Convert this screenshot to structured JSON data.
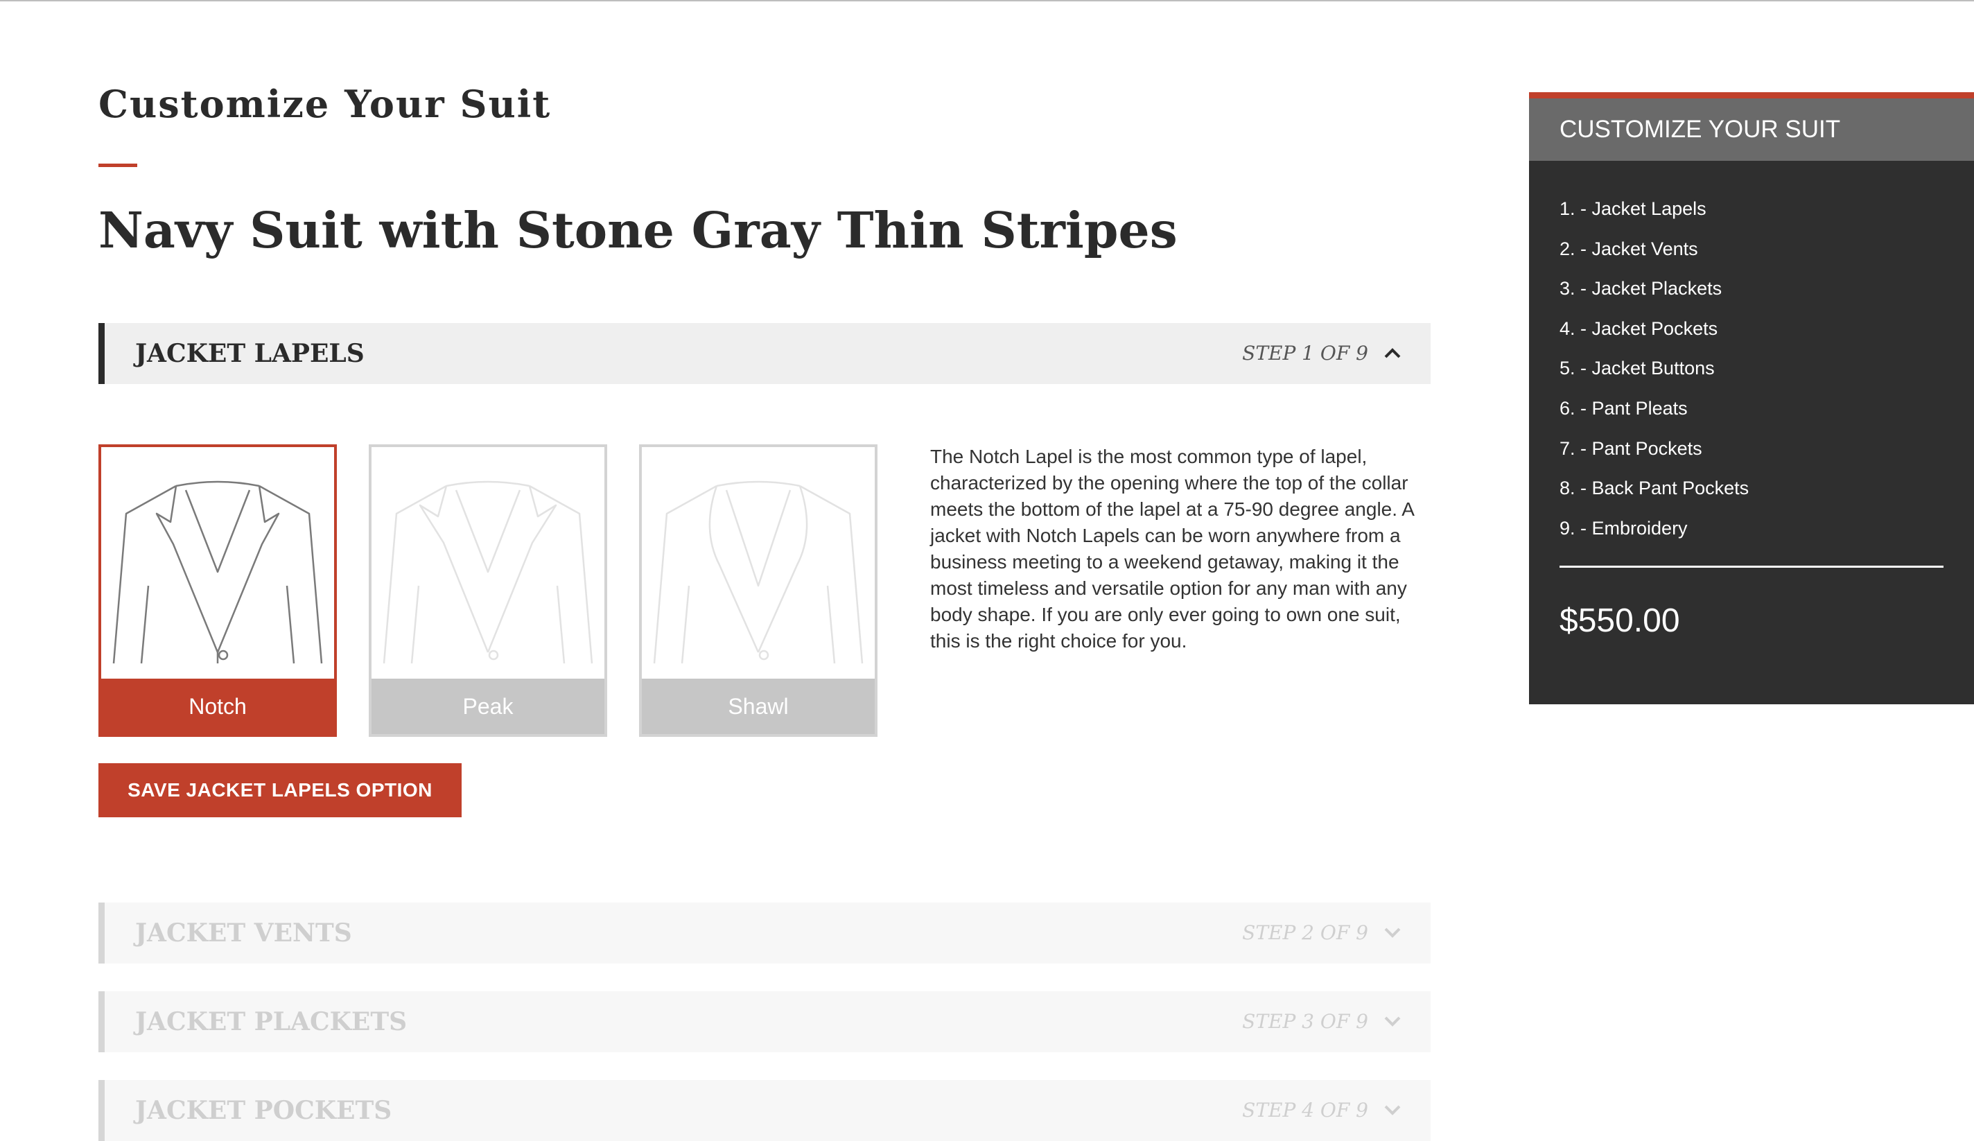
{
  "page": {
    "title": "Customize Your Suit",
    "suit_name": "Navy Suit with Stone Gray Thin Stripes"
  },
  "steps": [
    {
      "title": "Jacket Lapels",
      "count": "STEP 1 OF 9",
      "state": "expanded"
    },
    {
      "title": "Jacket Vents",
      "count": "STEP 2 OF 9",
      "state": "collapsed"
    },
    {
      "title": "Jacket Plackets",
      "count": "STEP 3 OF 9",
      "state": "collapsed"
    },
    {
      "title": "Jacket Pockets",
      "count": "STEP 4 OF 9",
      "state": "collapsed"
    }
  ],
  "lapel_options": [
    {
      "label": "Notch",
      "selected": true
    },
    {
      "label": "Peak",
      "selected": false
    },
    {
      "label": "Shawl",
      "selected": false
    }
  ],
  "description": "The Notch Lapel is the most common type of lapel, characterized by the opening where the top of the collar meets the bottom of the lapel at a 75-90 degree angle. A jacket with Notch Lapels can be worn anywhere from a business meeting to a weekend getaway, making it the most timeless and versatile option for any man with any body shape. If you are only ever going to own one suit, this is the right choice for you.",
  "save_button": "SAVE JACKET LAPELS OPTION",
  "sidebar": {
    "title": "CUSTOMIZE YOUR SUIT",
    "items": [
      "1. - Jacket Lapels",
      "2. - Jacket Vents",
      "3. - Jacket Plackets",
      "4. - Jacket Pockets",
      "5. - Jacket Buttons",
      "6. - Pant Pleats",
      "7. - Pant Pockets",
      "8. - Back Pant Pockets",
      "9. - Embroidery"
    ],
    "price": "$550.00"
  },
  "icons": {
    "expanded": "chevron-up-icon",
    "collapsed": "chevron-down-icon",
    "options": [
      "notch-lapel-jacket-icon",
      "peak-lapel-jacket-icon",
      "shawl-lapel-jacket-icon"
    ]
  },
  "colors": {
    "accent": "#c0402b",
    "dark": "#2f2f2f",
    "sidebar_header": "#6a6a6a",
    "inactive_label": "#c6c6c6"
  }
}
